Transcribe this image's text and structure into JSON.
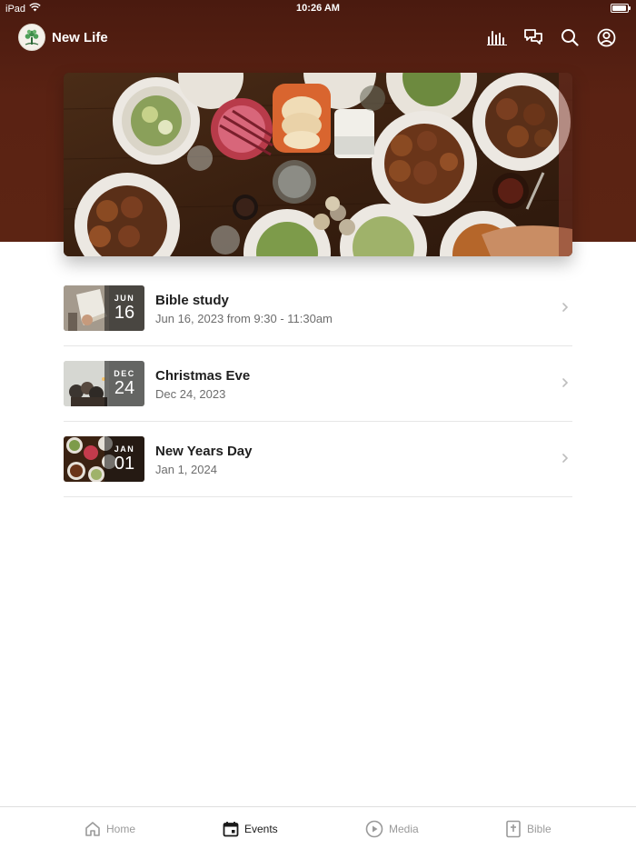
{
  "status_bar": {
    "device": "iPad",
    "time": "10:26 AM",
    "battery_level": 0.85
  },
  "header": {
    "app_name": "New Life",
    "icons": [
      "equalizer-icon",
      "chat-icon",
      "search-icon",
      "account-icon"
    ]
  },
  "hero": {
    "image": "food-table-photo"
  },
  "events": [
    {
      "month": "JUN",
      "day": "16",
      "title": "Bible study",
      "subtitle": "Jun 16, 2023 from 9:30 - 11:30am",
      "thumb": "bible-photo"
    },
    {
      "month": "DEC",
      "day": "24",
      "title": "Christmas Eve",
      "subtitle": "Dec 24, 2023",
      "thumb": "candle-photo"
    },
    {
      "month": "JAN",
      "day": "01",
      "title": "New Years Day",
      "subtitle": "Jan 1, 2024",
      "thumb": "food-photo"
    }
  ],
  "tabs": [
    {
      "label": "Home",
      "icon": "home-icon",
      "active": false
    },
    {
      "label": "Events",
      "icon": "calendar-icon",
      "active": true
    },
    {
      "label": "Media",
      "icon": "play-icon",
      "active": false
    },
    {
      "label": "Bible",
      "icon": "bible-icon",
      "active": false
    }
  ],
  "colors": {
    "header_bg": "#5a2213",
    "text_primary": "#1f1f1f",
    "text_secondary": "#6d6d6d",
    "tab_inactive": "#9a9a9a"
  }
}
